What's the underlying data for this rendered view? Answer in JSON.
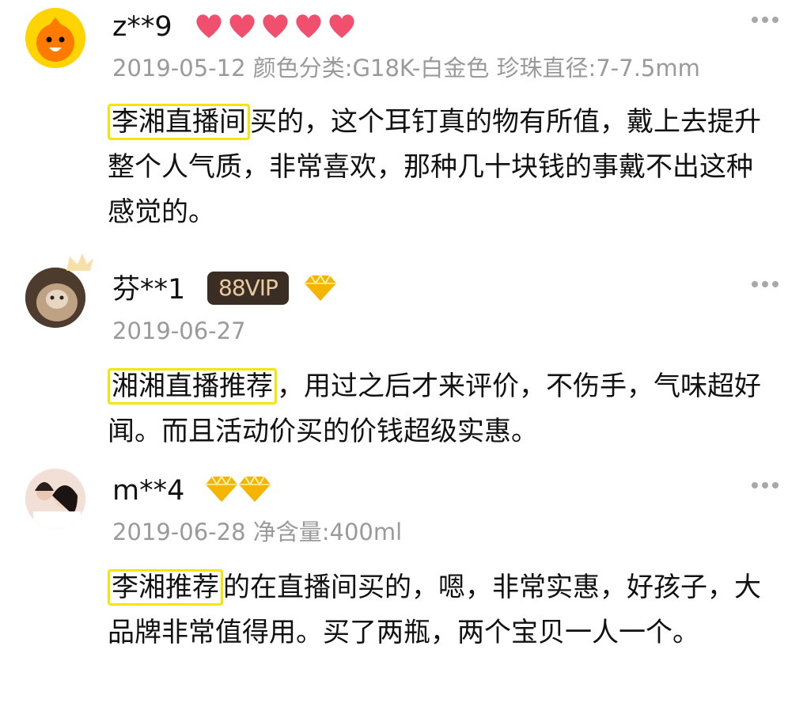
{
  "reviews": [
    {
      "username": "z**9",
      "meta": "2019-05-12 颜色分类:G18K-白金色 珍珠直径:7-7.5mm",
      "highlight": "李湘直播间",
      "text": "买的，这个耳钉真的物有所值，戴上去提升整个人气质，非常喜欢，那种几十块钱的事戴不出这种感觉的。",
      "badge_icon": "heart-icon",
      "badge_count": 5
    },
    {
      "username": "芬**1",
      "vip_label": "88VIP",
      "meta": "2019-06-27",
      "highlight": "湘湘直播推荐",
      "text": "，用过之后才来评价，不伤手，气味超好闻。而且活动价买的价钱超级实惠。",
      "badge_icon": "diamond-icon",
      "badge_count": 1
    },
    {
      "username": "m**4",
      "meta": "2019-06-28 净含量:400ml",
      "highlight": "李湘推荐",
      "text": "的在直播间买的，嗯，非常实惠，好孩子，大品牌非常值得用。买了两瓶，两个宝贝一人一个。",
      "badge_icon": "diamond-icon",
      "badge_count": 2
    }
  ],
  "colors": {
    "highlight_border": "#f3e600",
    "meta_text": "#9a9a9a",
    "heart": "#f0506e",
    "diamond": "#f5b400"
  }
}
